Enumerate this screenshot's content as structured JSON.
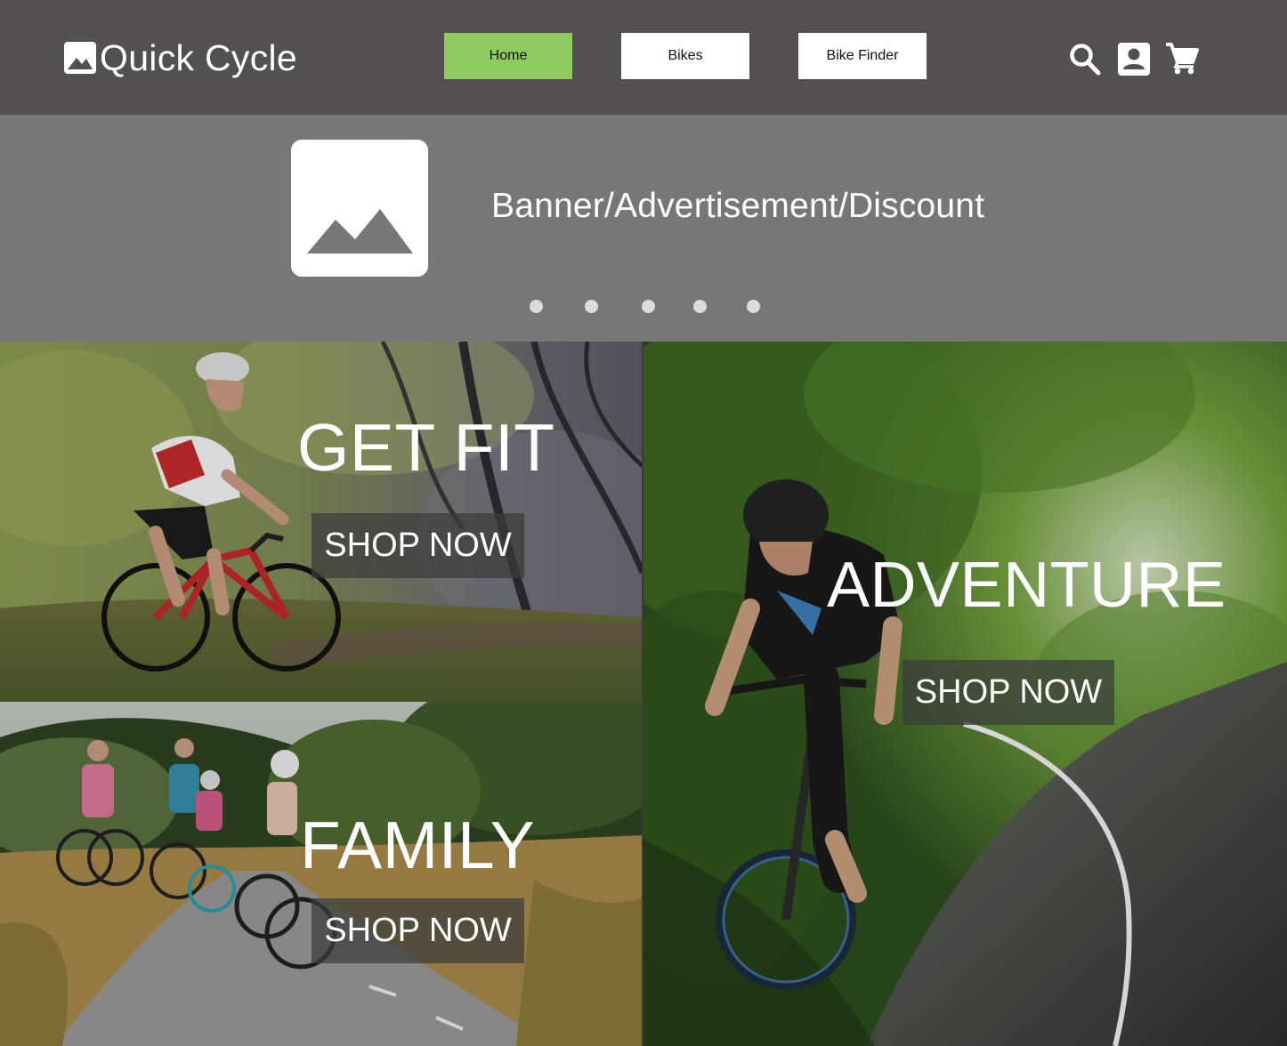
{
  "header": {
    "logo_text": "Quick Cycle",
    "nav": [
      {
        "label": "Home",
        "active": true
      },
      {
        "label": "Bikes",
        "active": false
      },
      {
        "label": "Bike Finder",
        "active": false
      }
    ],
    "icons": [
      "search-icon",
      "account-icon",
      "cart-icon"
    ]
  },
  "banner": {
    "text": "Banner/Advertisement/Discount",
    "image_icon": "image-placeholder-icon",
    "carousel_dots": 5
  },
  "tiles": {
    "fit": {
      "title": "GET FIT",
      "button": "SHOP NOW"
    },
    "family": {
      "title": "FAMILY",
      "button": "SHOP NOW"
    },
    "adventure": {
      "title": "ADVENTURE",
      "button": "SHOP NOW"
    }
  },
  "colors": {
    "header_bg": "#545052",
    "nav_active": "#8fca62",
    "nav_default": "#ffffff",
    "banner_bg": "#777777",
    "dot": "#dcdcdc"
  }
}
